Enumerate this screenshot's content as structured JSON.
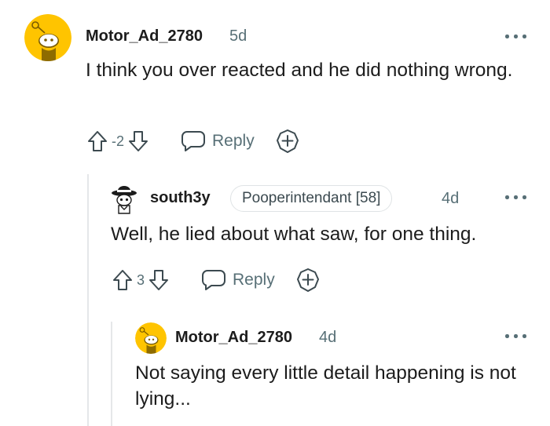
{
  "comments": [
    {
      "username": "Motor_Ad_2780",
      "time": "5d",
      "body": "I think you over reacted and he did nothing wrong.",
      "score": "-2",
      "reply_label": "Reply"
    },
    {
      "username": "south3y",
      "flair": "Pooperintendant [58]",
      "time": "4d",
      "body": "Well, he lied about what saw, for one thing.",
      "score": "3",
      "reply_label": "Reply"
    },
    {
      "username": "Motor_Ad_2780",
      "time": "4d",
      "body": "Not saying every little detail happening is not lying..."
    }
  ],
  "colors": {
    "avatar_yellow": "#ffc400",
    "meta_gray": "#576f76",
    "thread_line": "#e5e7e9"
  },
  "icons": [
    "snoo-avatar-icon",
    "upvote-icon",
    "downvote-icon",
    "comment-bubble-icon",
    "award-plus-icon",
    "more-options-icon"
  ]
}
